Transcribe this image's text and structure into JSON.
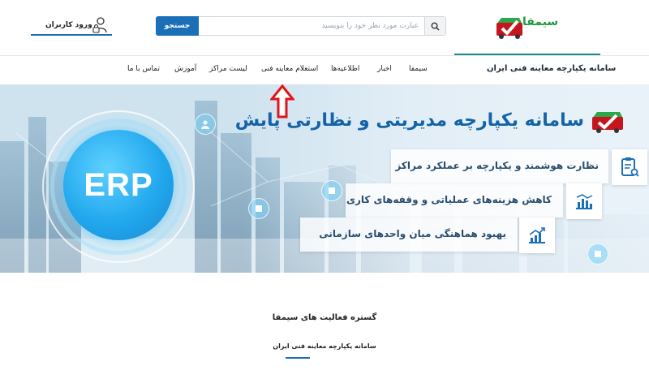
{
  "header": {
    "logo_text": "سیمفا",
    "search_button": "جستجو",
    "search_placeholder": "عبارت مورد نظر خود را بنویسید",
    "login_label": "ورود کاربران"
  },
  "nav": {
    "site_title": "سامانه یکپارچه معاینه فنی ایران",
    "items": [
      "سیمفا",
      "اخبار",
      "اطلاعیه‌ها",
      "استعلام معاینه فنی",
      "لیست مراکز",
      "آموزش",
      "تماس با ما"
    ]
  },
  "hero": {
    "title": "سامانه یکپارچه مدیریتی و نظارتی پایش",
    "badge": "ERP",
    "features": [
      {
        "text": "نظارت هوشمند و یکپارچه بر عملکرد مراکز",
        "icon": "clipboard-icon"
      },
      {
        "text": "کاهش هزینه‌های عملیاتی و وقفه‌های کاری",
        "icon": "bar-chart-icon"
      },
      {
        "text": "بهبود هماهنگی میان واحدهای سازمانی",
        "icon": "growth-chart-icon"
      }
    ]
  },
  "section": {
    "title": "گستره فعالیت های سیمفا",
    "subtitle": "سامانه یکپارچه معاینه فنی ایران"
  },
  "colors": {
    "primary": "#1b6fb7",
    "brand_green": "#1f9a3f",
    "annotation_red": "#e0151b",
    "hero_title": "#1463a8"
  }
}
